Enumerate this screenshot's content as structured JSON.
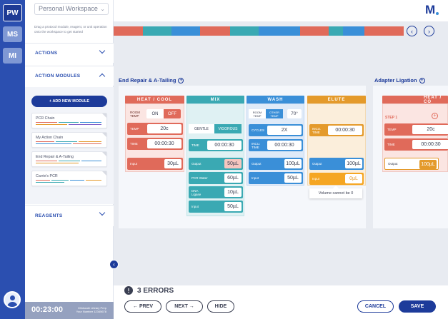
{
  "rail": {
    "workspaces": [
      "PW",
      "MS",
      "MI"
    ]
  },
  "panel": {
    "workspace_select": "Personal Workspace",
    "hint": "Drag a protocol module, reagent, or unit operation onto the workspace to get started",
    "actions_label": "ACTIONS",
    "modules_label": "ACTION MODULES",
    "add_module_label": "+ ADD NEW MODULE",
    "modules": [
      {
        "name": "PCR Chain"
      },
      {
        "name": "My Action Chain"
      },
      {
        "name": "End Repair & A-Tailing"
      },
      {
        "name": "Carrie's PCR"
      }
    ],
    "reagents_label": "REAGENTS",
    "timer": "00:23:00",
    "library_line1": "Miniscule Library Prep",
    "library_line2": "Your Number 12345678"
  },
  "header": {
    "logo": "M"
  },
  "canvas": {
    "groups": [
      {
        "title": "End Repair & A-Tailing"
      },
      {
        "title": "Adapter Ligation"
      }
    ],
    "heat_cool": {
      "title": "HEAT / COOL",
      "room_temp": "ROOM TEMP",
      "on": "ON",
      "off": "OFF",
      "temp_label": "TEMP",
      "temp": "20c",
      "time_label": "TIME",
      "time": "00:00:30",
      "input_label": "Input",
      "input": "30µL"
    },
    "mix": {
      "title": "MIX",
      "gentle": "GENTLE",
      "vigorous": "VIGOROUS",
      "time_label": "TIME",
      "time": "00:00:30",
      "output_label": "Output",
      "output": "50µL",
      "pcr_water_label": "PCR Water",
      "pcr_water": "60µL",
      "dna_ligase_label": "DNA Ligase",
      "dna_ligase": "10µL",
      "input_label": "Input",
      "input": "50µL"
    },
    "wash": {
      "title": "WASH",
      "room_temp": "ROOM TEMP",
      "other_temp": "OTHER TEMP",
      "temp": "70°",
      "cycles_label": "CYCLES",
      "cycles": "2X",
      "incu_label": "INCU. TIME",
      "incu": "00:00:30",
      "output_label": "Output",
      "output": "100µL",
      "input_label": "Input",
      "input": "50µL"
    },
    "elute": {
      "title": "ELUTE",
      "incu_label": "INCU. TIME",
      "incu": "00:00:30",
      "output_label": "Output",
      "output": "100µL",
      "input_label": "Input",
      "input": "0µL",
      "error": "Volume cannot be 0"
    },
    "heat_cool_2": {
      "title": "HEAT / CO",
      "step_label": "STEP 1",
      "temp_label": "TEMP",
      "temp": "20c",
      "time_label": "TIME",
      "time": "00:00:30",
      "output_label": "Output",
      "output": "100µL"
    }
  },
  "footer": {
    "errors": "3 ERRORS",
    "prev": "PREV",
    "next": "NEXT",
    "hide": "HIDE",
    "cancel": "CANCEL",
    "save": "SAVE"
  }
}
